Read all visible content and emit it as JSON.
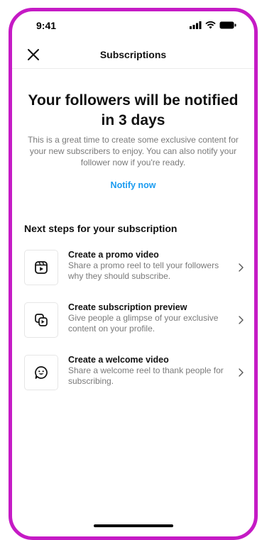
{
  "status_bar": {
    "time": "9:41"
  },
  "header": {
    "title": "Subscriptions"
  },
  "main": {
    "headline": "Your followers will be notified in 3 days",
    "description": "This is a great time to create some exclusive content for your new subscribers to enjoy. You can also notify your follower now if you're ready.",
    "notify_link": "Notify now"
  },
  "next_steps": {
    "title": "Next steps for your subscription",
    "items": [
      {
        "title": "Create a promo video",
        "description": "Share a promo reel to tell your followers why they should subscribe.",
        "icon": "reel-icon"
      },
      {
        "title": "Create subscription preview",
        "description": "Give people a glimpse of your exclusive content on your profile.",
        "icon": "preview-icon"
      },
      {
        "title": "Create a welcome video",
        "description": "Share a welcome reel to thank people for subscribing.",
        "icon": "smile-chat-icon"
      }
    ]
  },
  "colors": {
    "frame": "#c51ac5",
    "link": "#1a9bf0",
    "muted_text": "#7a7a7a"
  }
}
